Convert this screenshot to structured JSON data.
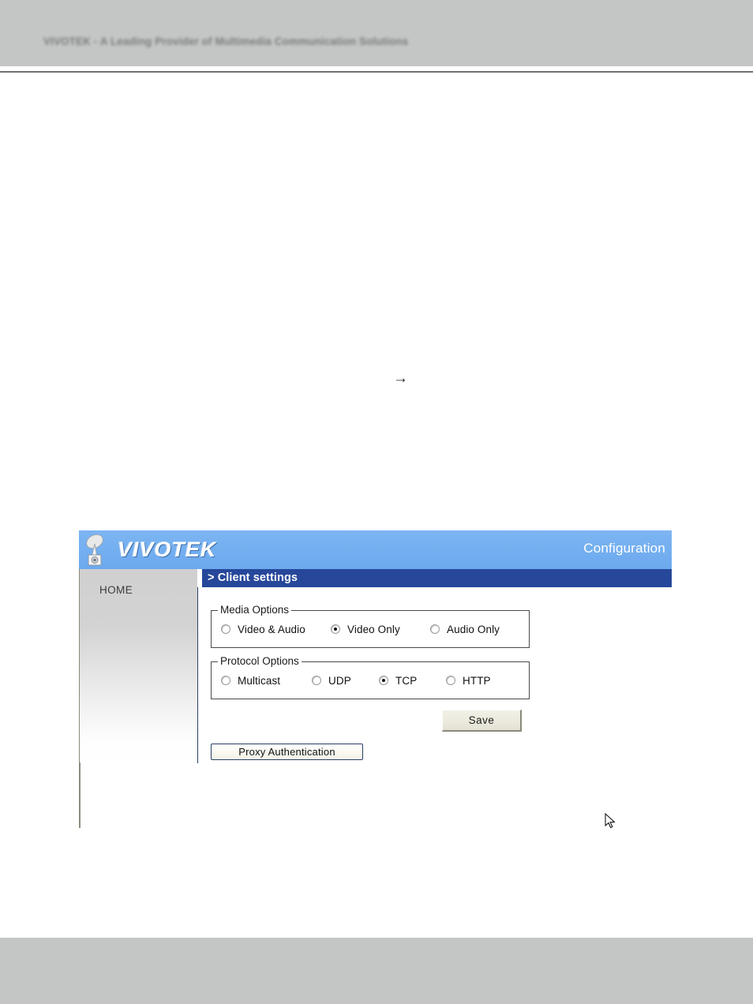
{
  "page": {
    "header_text": "VIVOTEK - A Leading Provider of Multimedia Communication Solutions",
    "body_arrow": "→"
  },
  "device_ui": {
    "brand": "VIVOTEK",
    "section_label": "Configuration",
    "page_title": "> Client settings",
    "sidebar": {
      "items": [
        {
          "label": "HOME"
        }
      ]
    },
    "media_options": {
      "legend": "Media Options",
      "options": [
        {
          "label": "Video & Audio",
          "checked": false
        },
        {
          "label": "Video Only",
          "checked": true
        },
        {
          "label": "Audio Only",
          "checked": false
        }
      ]
    },
    "protocol_options": {
      "legend": "Protocol Options",
      "options": [
        {
          "label": "Multicast",
          "checked": false
        },
        {
          "label": "UDP",
          "checked": false
        },
        {
          "label": "TCP",
          "checked": true
        },
        {
          "label": "HTTP",
          "checked": false
        }
      ]
    },
    "buttons": {
      "save": "Save",
      "proxy_authentication": "Proxy Authentication"
    },
    "colors": {
      "titlebar_blue": "#71aef0",
      "pagetitle_blue": "#26479a",
      "page_chrome_gray": "#c3c6c5",
      "button_face": "#ece9dd"
    }
  }
}
